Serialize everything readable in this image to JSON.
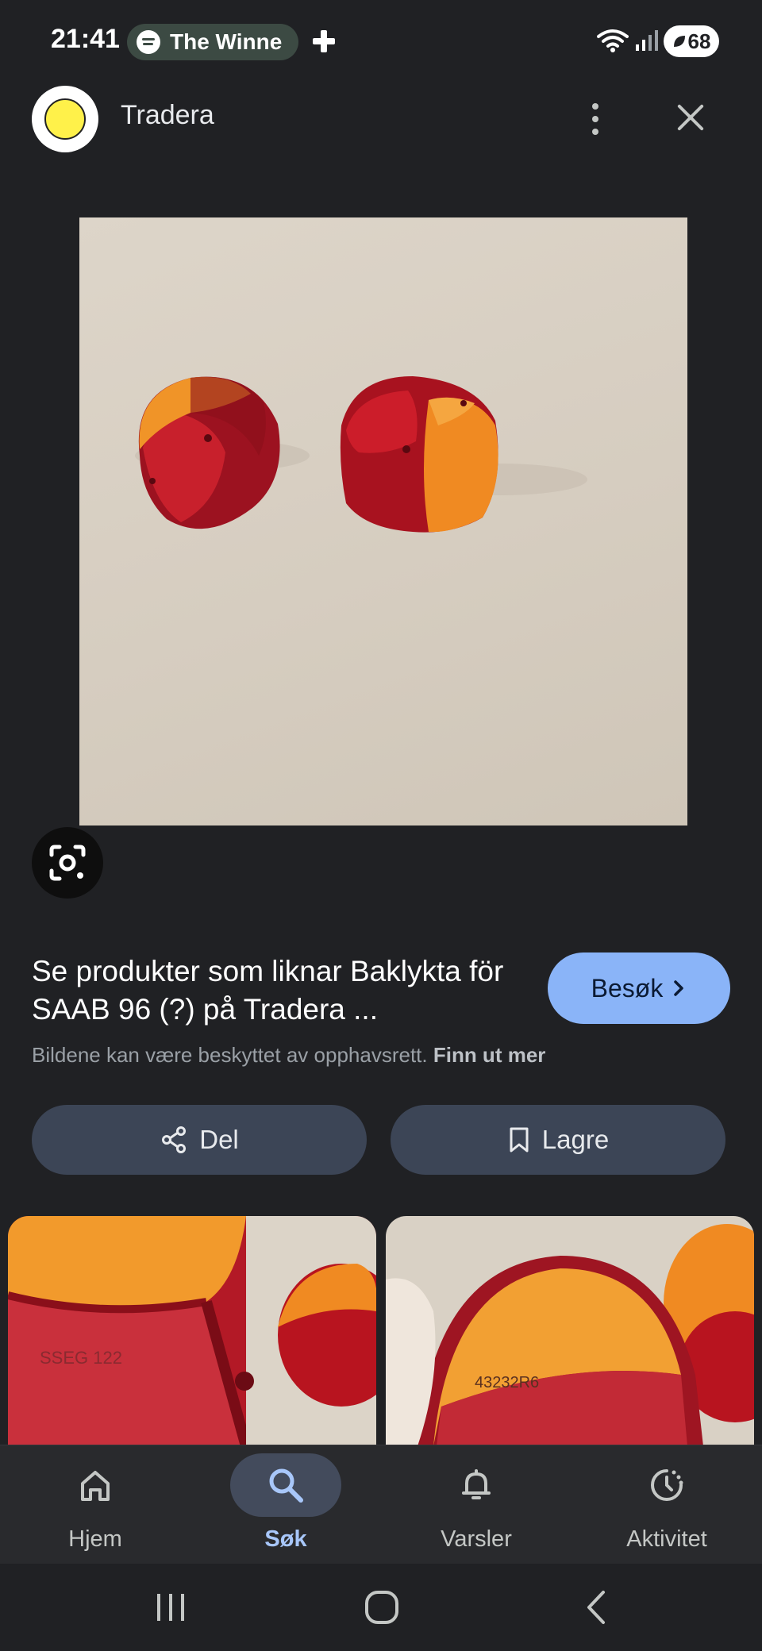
{
  "status_bar": {
    "time": "21:41",
    "media_text": "The Winne",
    "battery": "68",
    "icons": [
      "spotify-icon",
      "plus-icon",
      "wifi-icon",
      "signal-icon",
      "battery-icon"
    ]
  },
  "header": {
    "site_name": "Tradera",
    "logo_text": "TRADERA"
  },
  "result": {
    "title": "Se produkter som liknar Baklykta för SAAB 96 (?) på Tradera ...",
    "visit_label": "Besøk",
    "copyright_note": "Bildene kan være beskyttet av opphavsrett.",
    "copyright_link": "Finn ut mer"
  },
  "actions": {
    "share_label": "Del",
    "save_label": "Lagre"
  },
  "thumbnails": {
    "thumb_2_text": "43232R6"
  },
  "bottom_nav": {
    "items": [
      {
        "label": "Hjem",
        "icon": "home-icon"
      },
      {
        "label": "Søk",
        "icon": "search-icon",
        "active": true
      },
      {
        "label": "Varsler",
        "icon": "bell-icon"
      },
      {
        "label": "Aktivitet",
        "icon": "activity-icon"
      }
    ]
  },
  "colors": {
    "background": "#202124",
    "accent": "#8ab4f8",
    "action_button": "#3c4556",
    "active_nav": "#a8c7fa"
  }
}
